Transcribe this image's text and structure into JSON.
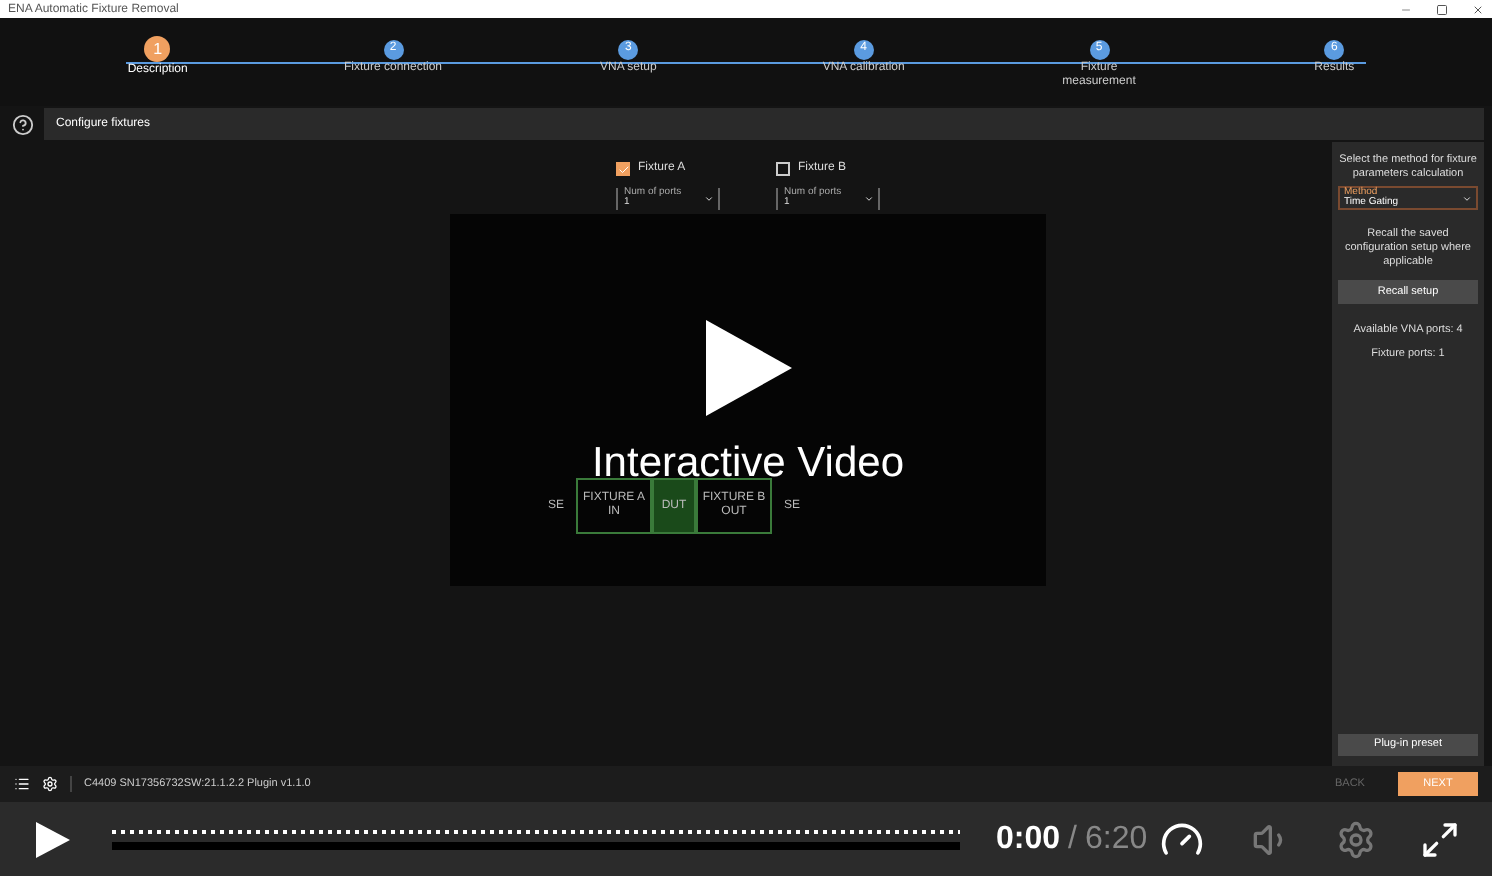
{
  "window": {
    "title": "ENA Automatic Fixture Removal"
  },
  "steps": [
    {
      "number": "1",
      "label": "Description",
      "selected": true
    },
    {
      "number": "2",
      "label": "Fixture connection",
      "selected": false
    },
    {
      "number": "3",
      "label": "VNA setup",
      "selected": false
    },
    {
      "number": "4",
      "label": "VNA calibration",
      "selected": false
    },
    {
      "number": "5",
      "label": "Fixture measurement",
      "selected": false
    },
    {
      "number": "6",
      "label": "Results",
      "selected": false
    }
  ],
  "section_title": "Configure fixtures",
  "fixtures": [
    {
      "label": "Fixture A",
      "checked": true,
      "field_label": "Num of ports",
      "value": "1"
    },
    {
      "label": "Fixture B",
      "checked": false,
      "field_label": "Num of ports",
      "value": "1"
    }
  ],
  "diagram": {
    "left_port": "SE",
    "fixture_a": "FIXTURE A IN",
    "dut": "DUT",
    "fixture_b": "FIXTURE B OUT",
    "right_port": "SE"
  },
  "side_panel": {
    "method_hint": "Select the method for fixture parameters calculation",
    "method_label": "Method",
    "method_value": "Time Gating",
    "recall_hint": "Recall the saved configuration setup where applicable",
    "recall_button": "Recall setup",
    "vna_ports": "Available VNA ports: 4",
    "fixture_ports": "Fixture ports: 1",
    "preset_button": "Plug-in preset"
  },
  "status_bar": {
    "text": "C4409 SN17356732SW:21.1.2.2 Plugin v1.1.0",
    "back": {
      "label": "BACK",
      "disabled": true
    },
    "next": {
      "label": "NEXT",
      "disabled": false
    }
  },
  "video": {
    "overlay_title": "Interactive Video",
    "current_time": "0:00",
    "separator": "/",
    "duration": "6:20",
    "level": 0
  }
}
